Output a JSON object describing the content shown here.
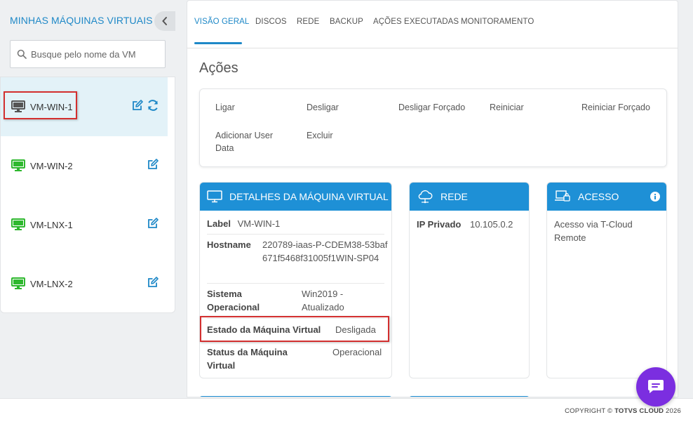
{
  "sidebar": {
    "title": "MINHAS MÁQUINAS VIRTUAIS",
    "search_placeholder": "Busque pelo nome da VM",
    "vms": [
      {
        "label": "VM-WIN-1",
        "status_color": "#555555",
        "active": true
      },
      {
        "label": "VM-WIN-2",
        "status_color": "#2eb82e",
        "active": false
      },
      {
        "label": "VM-LNX-1",
        "status_color": "#2eb82e",
        "active": false
      },
      {
        "label": "VM-LNX-2",
        "status_color": "#2eb82e",
        "active": false
      }
    ]
  },
  "tabs": [
    {
      "label": "VISÃO GERAL",
      "active": true
    },
    {
      "label": "DISCOS"
    },
    {
      "label": "REDE"
    },
    {
      "label": "BACKUP"
    },
    {
      "label": "AÇÕES EXECUTADAS"
    },
    {
      "label": "MONITORAMENTO"
    }
  ],
  "actions_section": {
    "title": "Ações",
    "items": [
      "Ligar",
      "Desligar",
      "Desligar Forçado",
      "Reiniciar",
      "Reiniciar Forçado",
      "Adicionar User Data",
      "Excluir"
    ]
  },
  "details_panel": {
    "title": "DETALHES DA MÁQUINA VIRTUAL",
    "label_key": "Label",
    "label_value": "VM-WIN-1",
    "hostname_key": "Hostname",
    "hostname_value": "220789-iaas-P-CDEM38-53baf671f5468f31005f1WIN-SP04",
    "os_key": "Sistema Operacional",
    "os_value": "Win2019 - Atualizado",
    "state_key": "Estado da Máquina Virtual",
    "state_value": "Desligada",
    "status_key": "Status da Máquina Virtual",
    "status_value": "Operacional"
  },
  "network_panel": {
    "title": "REDE",
    "ip_key": "IP Privado",
    "ip_value": "10.105.0.2"
  },
  "access_panel": {
    "title": "ACESSO",
    "text": "Acesso via T-Cloud Remote"
  },
  "footer": {
    "prefix": "COPYRIGHT © ",
    "brand": "TOTVS CLOUD",
    "year": " 2026"
  },
  "colors": {
    "accent": "#1e88c7",
    "panel_header": "#1e90d6",
    "chat_button": "#7b2ee0",
    "highlight": "#d32f2f"
  }
}
